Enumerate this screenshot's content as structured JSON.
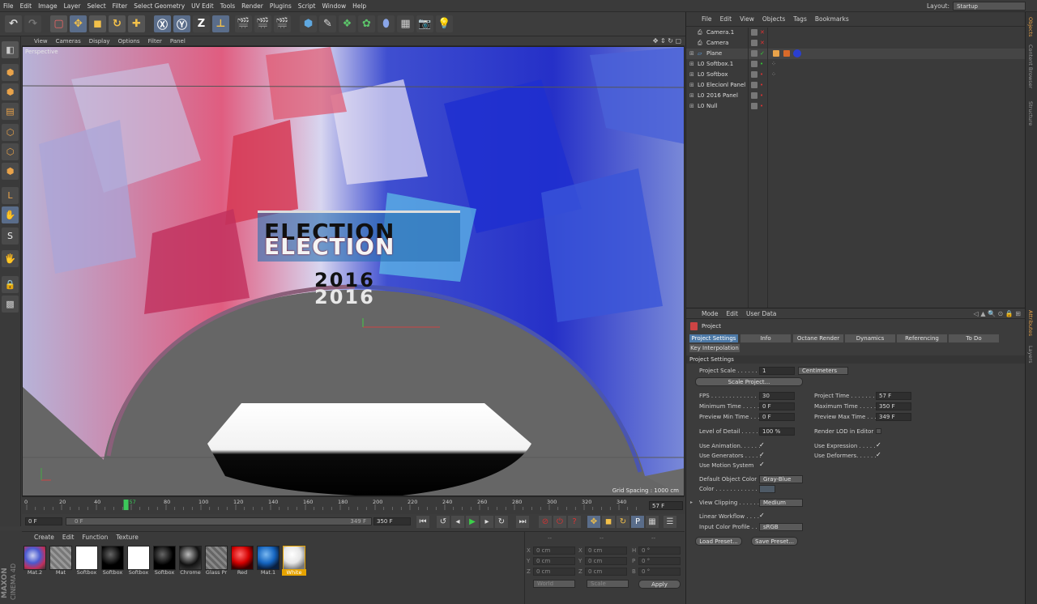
{
  "menubar": [
    "File",
    "Edit",
    "Image",
    "Layer",
    "Select",
    "Filter",
    "Select Geometry",
    "UV Edit",
    "Tools",
    "Render",
    "Plugins",
    "Script",
    "Window",
    "Help"
  ],
  "layout": {
    "label": "Layout:",
    "value": "Startup"
  },
  "viewport_menu": [
    "View",
    "Cameras",
    "Display",
    "Options",
    "Filter",
    "Panel"
  ],
  "viewport": {
    "camera_label": "Perspective",
    "grid_spacing": "Grid Spacing : 1000 cm",
    "title1": "ELECTION",
    "title2": "ELECTION",
    "year1": "2016",
    "year2": "2016"
  },
  "timeline": {
    "ticks": [
      "0",
      "20",
      "40",
      "57",
      "80",
      "100",
      "120",
      "140",
      "160",
      "180",
      "200",
      "220",
      "240",
      "260",
      "280",
      "300",
      "320",
      "340"
    ],
    "current_frame": "57 F"
  },
  "transport": {
    "start": "0 F",
    "slider_start": "0 F",
    "slider_end": "349 F",
    "end": "350 F"
  },
  "materials": {
    "menu": [
      "Create",
      "Edit",
      "Function",
      "Texture"
    ],
    "items": [
      {
        "name": "Mat.2"
      },
      {
        "name": "Mat"
      },
      {
        "name": "Softbox"
      },
      {
        "name": "Softbox"
      },
      {
        "name": "Softbox"
      },
      {
        "name": "Softbox"
      },
      {
        "name": "Chrome"
      },
      {
        "name": "Glass Pr"
      },
      {
        "name": "Red"
      },
      {
        "name": "Mat.1"
      },
      {
        "name": "White"
      }
    ]
  },
  "brand": {
    "maxon": "MAXON",
    "cinema": "CINEMA 4D"
  },
  "coordinates": {
    "header1": "--",
    "header2": "--",
    "header3": "--",
    "rows": [
      {
        "a": "X",
        "av": "0 cm",
        "b": "X",
        "bv": "0 cm",
        "c": "H",
        "cv": "0 °"
      },
      {
        "a": "Y",
        "av": "0 cm",
        "b": "Y",
        "bv": "0 cm",
        "c": "P",
        "cv": "0 °"
      },
      {
        "a": "Z",
        "av": "0 cm",
        "b": "Z",
        "bv": "0 cm",
        "c": "B",
        "cv": "0 °"
      }
    ],
    "world": "World",
    "scale": "Scale",
    "apply": "Apply"
  },
  "object_manager": {
    "menu": [
      "File",
      "Edit",
      "View",
      "Objects",
      "Tags",
      "Bookmarks"
    ],
    "objects": [
      {
        "name": "Camera.1"
      },
      {
        "name": "Camera"
      },
      {
        "name": "Plane"
      },
      {
        "name": "Softbox.1"
      },
      {
        "name": "Softbox"
      },
      {
        "name": "Elecionl Panel"
      },
      {
        "name": "2016 Panel"
      },
      {
        "name": "Null"
      }
    ]
  },
  "attributes": {
    "menu": [
      "Mode",
      "Edit",
      "User Data"
    ],
    "title": "Project",
    "tabs": [
      "Project Settings",
      "Info",
      "Octane Render",
      "Dynamics",
      "Referencing",
      "To Do"
    ],
    "tab2": "Key Interpolation",
    "section": "Project Settings",
    "project_scale_label": "Project Scale . . . . . .",
    "project_scale_value": "1",
    "project_scale_unit": "Centimeters",
    "scale_project_btn": "Scale Project...",
    "fps_label": "FPS . . . . . . . . . . . . .",
    "fps": "30",
    "project_time_label": "Project Time . . . . . . .",
    "project_time": "57 F",
    "min_time_label": "Minimum Time . . . . . .",
    "min_time": "0 F",
    "max_time_label": "Maximum Time . . . . . .",
    "max_time": "350 F",
    "prev_min_label": "Preview Min Time . . .",
    "prev_min": "0 F",
    "prev_max_label": "Preview Max Time . . .",
    "prev_max": "349 F",
    "lod_label": "Level of Detail . . . . .",
    "lod": "100 %",
    "render_lod_label": "Render LOD in Editor",
    "use_anim_label": "Use Animation. . . . . .",
    "use_expr_label": "Use Expression . . . . .",
    "use_gen_label": "Use Generators . . . . .",
    "use_def_label": "Use Deformers. . . . . .",
    "use_motion_label": "Use Motion System",
    "default_color_label": "Default Object Color",
    "default_color": "Gray-Blue",
    "color_label": "Color . . . . . . . . . . . .",
    "view_clip_label": "View Clipping . . . . . .",
    "view_clip": "Medium",
    "linear_label": "Linear Workflow . . . .",
    "input_profile_label": "Input Color Profile . .",
    "input_profile": "sRGB",
    "load_preset": "Load Preset...",
    "save_preset": "Save Preset..."
  },
  "right_tabs": [
    "Objects",
    "Content Browser",
    "Structure",
    "Attributes",
    "Layers"
  ]
}
